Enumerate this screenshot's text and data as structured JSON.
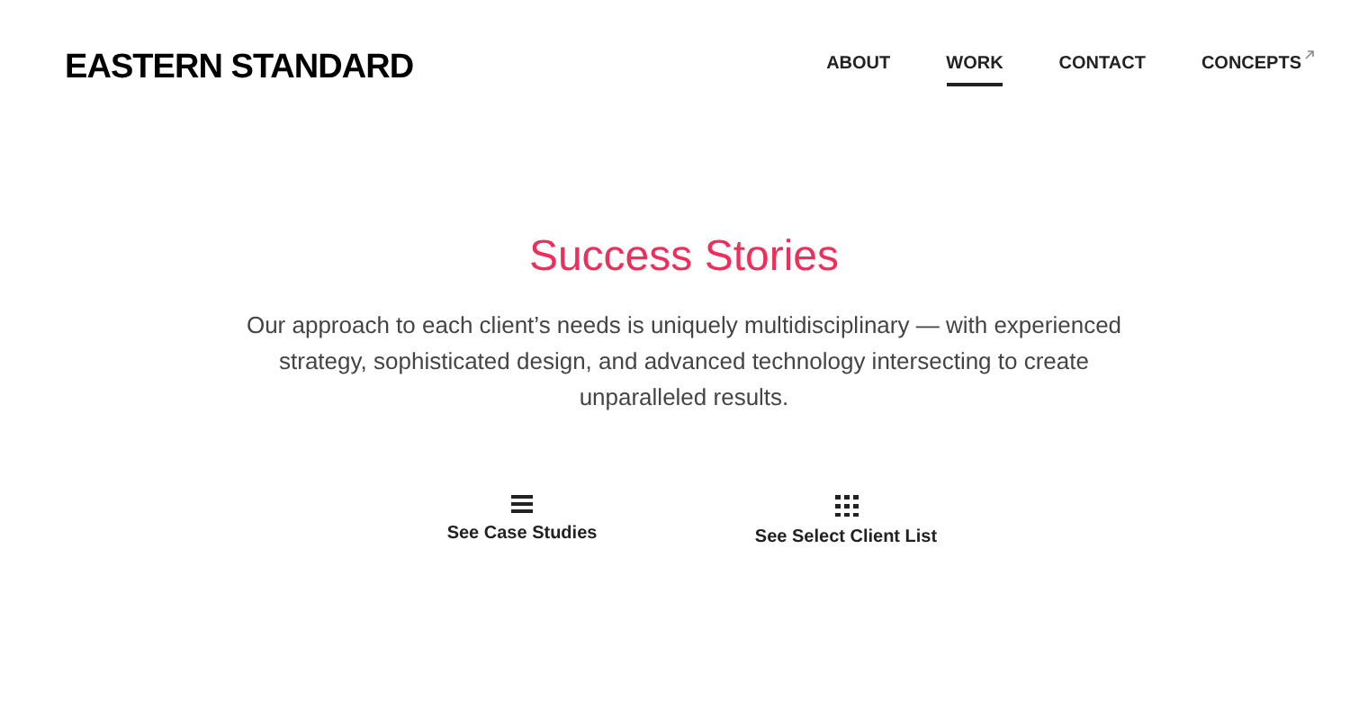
{
  "logo": "EASTERN STANDARD",
  "nav": [
    {
      "label": "ABOUT",
      "selected": false,
      "external": false
    },
    {
      "label": "WORK",
      "selected": true,
      "external": false
    },
    {
      "label": "CONTACT",
      "selected": false,
      "external": false
    },
    {
      "label": "CONCEPTS",
      "selected": false,
      "external": true
    }
  ],
  "hero": {
    "title": "Success Stories",
    "text": "Our approach to each client’s needs is uniquely multidisciplinary — with experienced strategy, sophisticated design, and advanced technology intersecting to create unparalleled results."
  },
  "links": [
    {
      "kind": "list",
      "label": "See Case Studies"
    },
    {
      "kind": "grid",
      "label": "See Select Client List"
    }
  ]
}
